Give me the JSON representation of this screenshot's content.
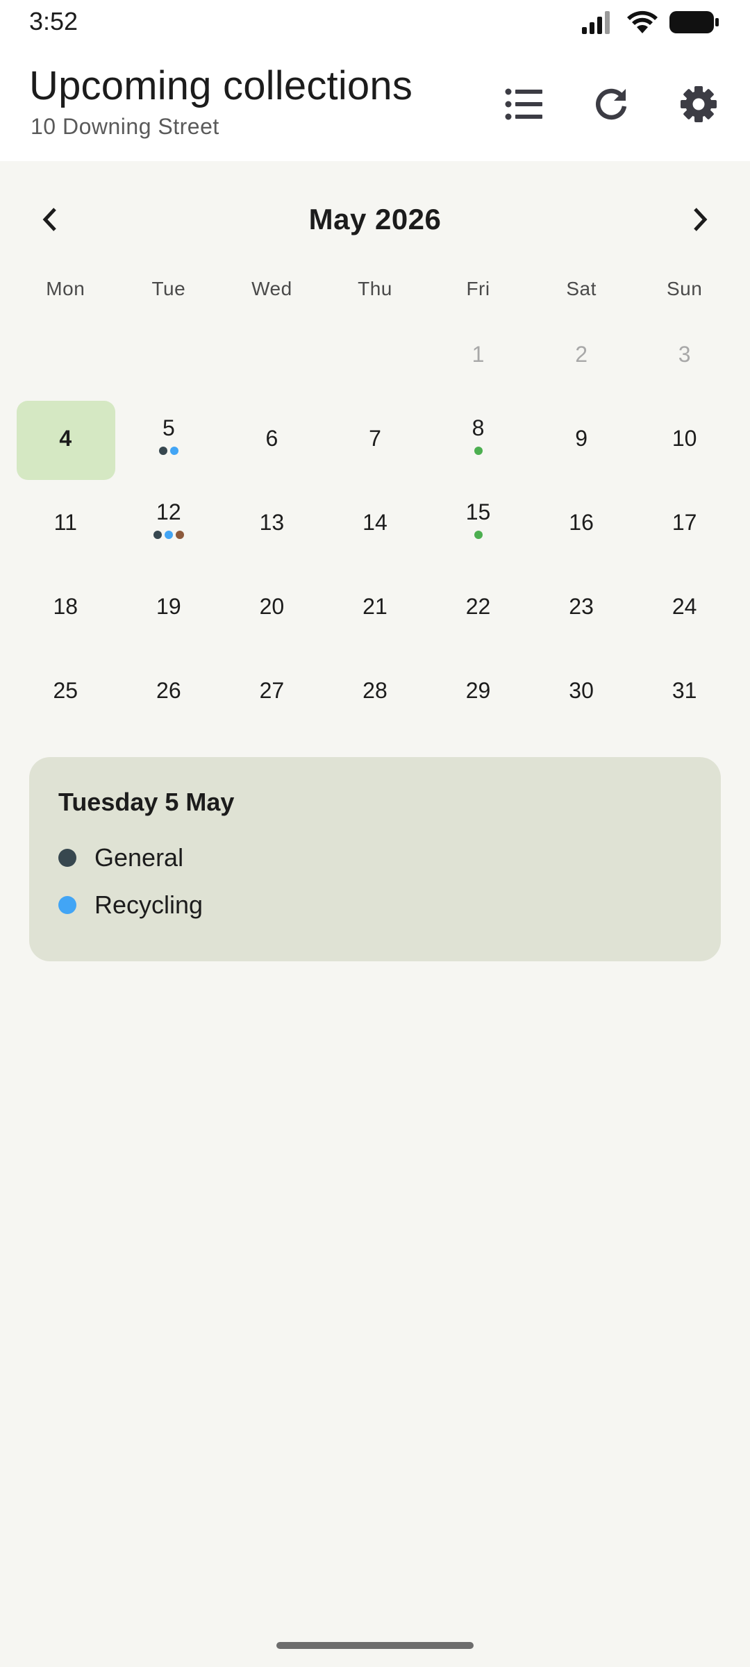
{
  "status_bar": {
    "time": "3:52"
  },
  "app_bar": {
    "title": "Upcoming collections",
    "subtitle": "10 Downing Street",
    "actions": [
      "list-icon",
      "refresh-icon",
      "settings-icon"
    ]
  },
  "calendar": {
    "month_label": "May 2026",
    "weekdays": [
      "Mon",
      "Tue",
      "Wed",
      "Thu",
      "Fri",
      "Sat",
      "Sun"
    ],
    "today": 4,
    "selected": 5,
    "days": [
      {
        "n": "",
        "dots": []
      },
      {
        "n": "",
        "dots": []
      },
      {
        "n": "",
        "dots": []
      },
      {
        "n": "",
        "dots": []
      },
      {
        "n": "1",
        "faded": true,
        "dots": []
      },
      {
        "n": "2",
        "faded": true,
        "dots": []
      },
      {
        "n": "3",
        "faded": true,
        "dots": []
      },
      {
        "n": "4",
        "today": true,
        "dots": []
      },
      {
        "n": "5",
        "dots": [
          "#37474f",
          "#42a5f5"
        ]
      },
      {
        "n": "6",
        "dots": []
      },
      {
        "n": "7",
        "dots": []
      },
      {
        "n": "8",
        "dots": [
          "#4caf50"
        ]
      },
      {
        "n": "9",
        "dots": []
      },
      {
        "n": "10",
        "dots": []
      },
      {
        "n": "11",
        "dots": []
      },
      {
        "n": "12",
        "dots": [
          "#37474f",
          "#42a5f5",
          "#8d5a3c"
        ]
      },
      {
        "n": "13",
        "dots": []
      },
      {
        "n": "14",
        "dots": []
      },
      {
        "n": "15",
        "dots": [
          "#4caf50"
        ]
      },
      {
        "n": "16",
        "dots": []
      },
      {
        "n": "17",
        "dots": []
      },
      {
        "n": "18",
        "dots": []
      },
      {
        "n": "19",
        "dots": []
      },
      {
        "n": "20",
        "dots": []
      },
      {
        "n": "21",
        "dots": []
      },
      {
        "n": "22",
        "dots": []
      },
      {
        "n": "23",
        "dots": []
      },
      {
        "n": "24",
        "dots": []
      },
      {
        "n": "25",
        "dots": []
      },
      {
        "n": "26",
        "dots": []
      },
      {
        "n": "27",
        "dots": []
      },
      {
        "n": "28",
        "dots": []
      },
      {
        "n": "29",
        "dots": []
      },
      {
        "n": "30",
        "dots": []
      },
      {
        "n": "31",
        "dots": []
      }
    ]
  },
  "detail": {
    "title": "Tuesday 5 May",
    "entries": [
      {
        "label": "General",
        "color": "#37474f"
      },
      {
        "label": "Recycling",
        "color": "#42a5f5"
      }
    ]
  },
  "colors": {
    "today_bg": "#d5e8c3",
    "card_bg": "#dfe2d4",
    "page_bg": "#f6f6f2"
  }
}
